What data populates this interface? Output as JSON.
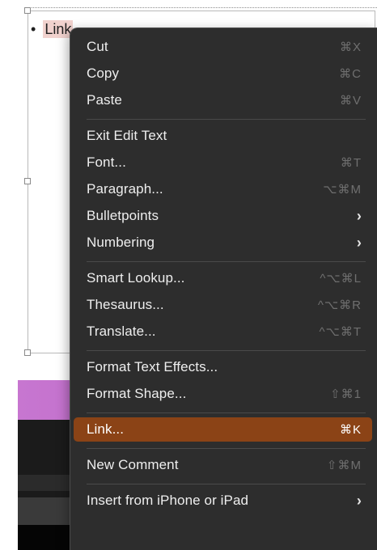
{
  "document": {
    "bullet_char": "•",
    "bullet_text": "Link"
  },
  "menu": {
    "groups": [
      [
        {
          "label": "Cut",
          "shortcut": "⌘X"
        },
        {
          "label": "Copy",
          "shortcut": "⌘C"
        },
        {
          "label": "Paste",
          "shortcut": "⌘V"
        }
      ],
      [
        {
          "label": "Exit Edit Text",
          "shortcut": ""
        },
        {
          "label": "Font...",
          "shortcut": "⌘T"
        },
        {
          "label": "Paragraph...",
          "shortcut": "⌥⌘M"
        },
        {
          "label": "Bulletpoints",
          "submenu": "›"
        },
        {
          "label": "Numbering",
          "submenu": "›"
        }
      ],
      [
        {
          "label": "Smart Lookup...",
          "shortcut": "^⌥⌘L"
        },
        {
          "label": "Thesaurus...",
          "shortcut": "^⌥⌘R"
        },
        {
          "label": "Translate...",
          "shortcut": "^⌥⌘T"
        }
      ],
      [
        {
          "label": "Format Text Effects...",
          "shortcut": ""
        },
        {
          "label": "Format Shape...",
          "shortcut": "⇧⌘1"
        }
      ],
      [
        {
          "label": "Link...",
          "shortcut": "⌘K",
          "selected": true
        }
      ],
      [
        {
          "label": "New Comment",
          "shortcut": "⇧⌘M"
        }
      ],
      [
        {
          "label": "Insert from iPhone or iPad",
          "submenu": "›"
        }
      ]
    ]
  },
  "colors": {
    "menu_bg": "#2d2d2d",
    "selected_bg": "#8b4316",
    "purple_band": "#c776d0"
  }
}
